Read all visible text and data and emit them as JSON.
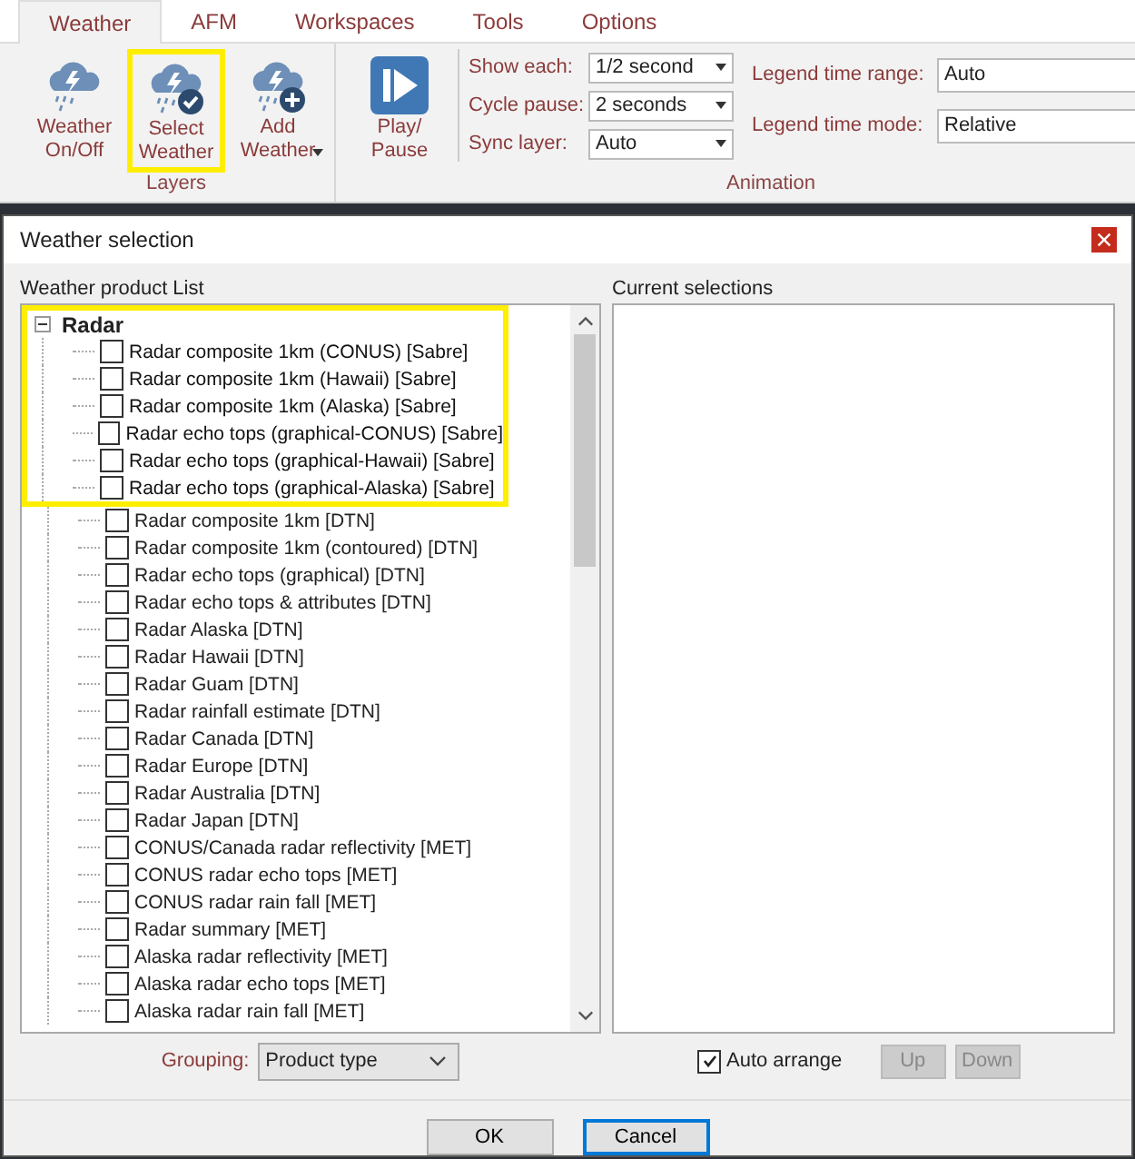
{
  "ribbon": {
    "tabs": [
      {
        "label": "Weather",
        "selected": true
      },
      {
        "label": "AFM",
        "selected": false
      },
      {
        "label": "Workspaces",
        "selected": false
      },
      {
        "label": "Tools",
        "selected": false
      },
      {
        "label": "Options",
        "selected": false
      }
    ],
    "layers": {
      "label": "Layers",
      "buttons": [
        {
          "kind": "onoff",
          "label": "Weather On/Off",
          "highlighted": false,
          "dropdown": false
        },
        {
          "kind": "select",
          "label": "Select Weather",
          "highlighted": true,
          "dropdown": false
        },
        {
          "kind": "add",
          "label": "Add Weather",
          "highlighted": false,
          "dropdown": true
        }
      ]
    },
    "animation": {
      "label": "Animation",
      "play": {
        "label": "Play/ Pause"
      },
      "settings": [
        {
          "label": "Show each:",
          "value": "1/2 second"
        },
        {
          "label": "Cycle pause:",
          "value": "2 seconds"
        },
        {
          "label": "Sync layer:",
          "value": "Auto"
        }
      ],
      "legend": [
        {
          "label": "Legend time range:",
          "value": "Auto"
        },
        {
          "label": "Legend time mode:",
          "value": "Relative"
        }
      ]
    }
  },
  "dialog": {
    "title": "Weather selection",
    "product_list": {
      "label": "Weather product List",
      "group": {
        "label": "Radar",
        "expanded": true,
        "highlighted": true,
        "children": [
          {
            "label": "Radar composite 1km (CONUS) [Sabre]",
            "checked": false,
            "highlighted": true
          },
          {
            "label": "Radar composite 1km (Hawaii) [Sabre]",
            "checked": false,
            "highlighted": true
          },
          {
            "label": "Radar composite 1km (Alaska) [Sabre]",
            "checked": false,
            "highlighted": true
          },
          {
            "label": "Radar echo tops (graphical-CONUS) [Sabre]",
            "checked": false,
            "highlighted": true
          },
          {
            "label": "Radar echo tops (graphical-Hawaii) [Sabre]",
            "checked": false,
            "highlighted": true
          },
          {
            "label": "Radar echo tops (graphical-Alaska) [Sabre]",
            "checked": false,
            "highlighted": true
          },
          {
            "label": "Radar composite 1km [DTN]",
            "checked": false,
            "highlighted": false
          },
          {
            "label": "Radar composite 1km (contoured) [DTN]",
            "checked": false,
            "highlighted": false
          },
          {
            "label": "Radar echo tops (graphical) [DTN]",
            "checked": false,
            "highlighted": false
          },
          {
            "label": "Radar echo tops & attributes [DTN]",
            "checked": false,
            "highlighted": false
          },
          {
            "label": "Radar Alaska [DTN]",
            "checked": false,
            "highlighted": false
          },
          {
            "label": "Radar Hawaii [DTN]",
            "checked": false,
            "highlighted": false
          },
          {
            "label": "Radar Guam [DTN]",
            "checked": false,
            "highlighted": false
          },
          {
            "label": "Radar rainfall estimate [DTN]",
            "checked": false,
            "highlighted": false
          },
          {
            "label": "Radar Canada [DTN]",
            "checked": false,
            "highlighted": false
          },
          {
            "label": "Radar Europe [DTN]",
            "checked": false,
            "highlighted": false
          },
          {
            "label": "Radar Australia [DTN]",
            "checked": false,
            "highlighted": false
          },
          {
            "label": "Radar Japan [DTN]",
            "checked": false,
            "highlighted": false
          },
          {
            "label": "CONUS/Canada radar reflectivity [MET]",
            "checked": false,
            "highlighted": false
          },
          {
            "label": "CONUS radar echo tops [MET]",
            "checked": false,
            "highlighted": false
          },
          {
            "label": "CONUS radar rain fall [MET]",
            "checked": false,
            "highlighted": false
          },
          {
            "label": "Radar summary [MET]",
            "checked": false,
            "highlighted": false
          },
          {
            "label": "Alaska radar reflectivity [MET]",
            "checked": false,
            "highlighted": false
          },
          {
            "label": "Alaska radar echo tops [MET]",
            "checked": false,
            "highlighted": false
          },
          {
            "label": "Alaska radar rain fall [MET]",
            "checked": false,
            "highlighted": false
          }
        ]
      }
    },
    "grouping": {
      "label": "Grouping:",
      "value": "Product type"
    },
    "current_selections": {
      "label": "Current selections"
    },
    "auto_arrange": {
      "label": "Auto arrange",
      "checked": true
    },
    "order_buttons": [
      {
        "label": "Up",
        "disabled": true
      },
      {
        "label": "Down",
        "disabled": true
      }
    ],
    "buttons": [
      {
        "label": "OK",
        "focused": false
      },
      {
        "label": "Cancel",
        "focused": true
      }
    ]
  }
}
